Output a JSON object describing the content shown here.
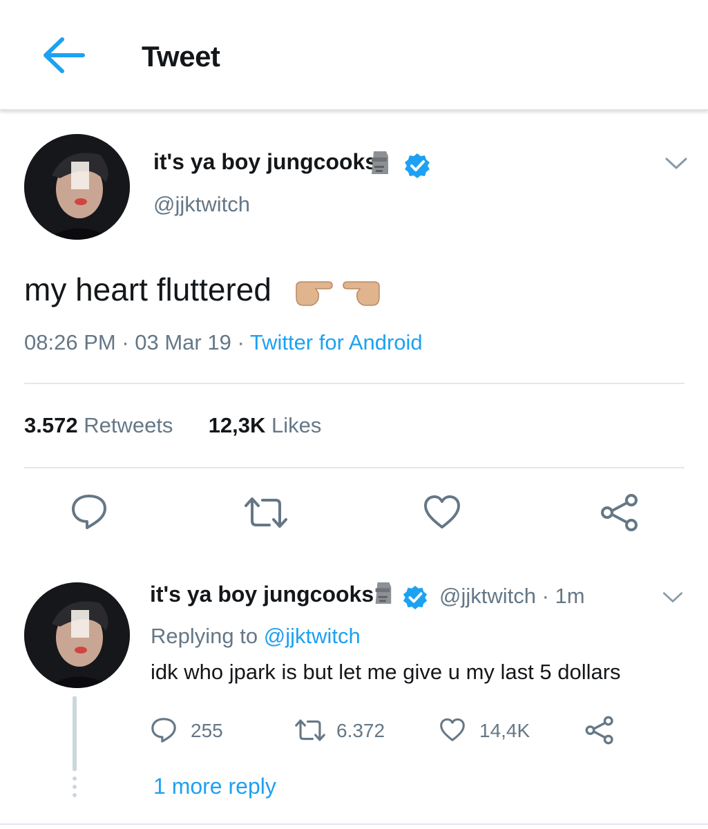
{
  "header": {
    "title": "Tweet"
  },
  "tweet": {
    "display_name": "it's ya boy jungcooks",
    "handle": "@jjktwitch",
    "text": "my heart fluttered",
    "time": "08:26 PM",
    "date": "03 Mar 19",
    "source": "Twitter for Android",
    "retweets_count": "3.572",
    "retweets_label": "Retweets",
    "likes_count": "12,3K",
    "likes_label": "Likes"
  },
  "reply": {
    "display_name": "it's ya boy jungcooks",
    "handle": "@jjktwitch",
    "age": "1m",
    "replying_prefix": "Replying to",
    "replying_to": "@jjktwitch",
    "text": "idk who jpark is but let me give u my last 5 dollars",
    "replies": "255",
    "retweets": "6.372",
    "likes": "14,4K"
  },
  "thread": {
    "more_replies": "1 more reply"
  },
  "icons": {
    "back": "arrow-left-icon",
    "verified": "verified-badge-icon",
    "moai": "moai-emoji-icon",
    "pointing": "pointing-hands-emoji-icon",
    "caret": "chevron-down-icon",
    "reply": "reply-icon",
    "retweet": "retweet-icon",
    "like": "heart-icon",
    "share": "share-icon"
  },
  "colors": {
    "accent": "#1da1f2",
    "secondary_text": "#657786",
    "divider": "#e1e8ed"
  }
}
